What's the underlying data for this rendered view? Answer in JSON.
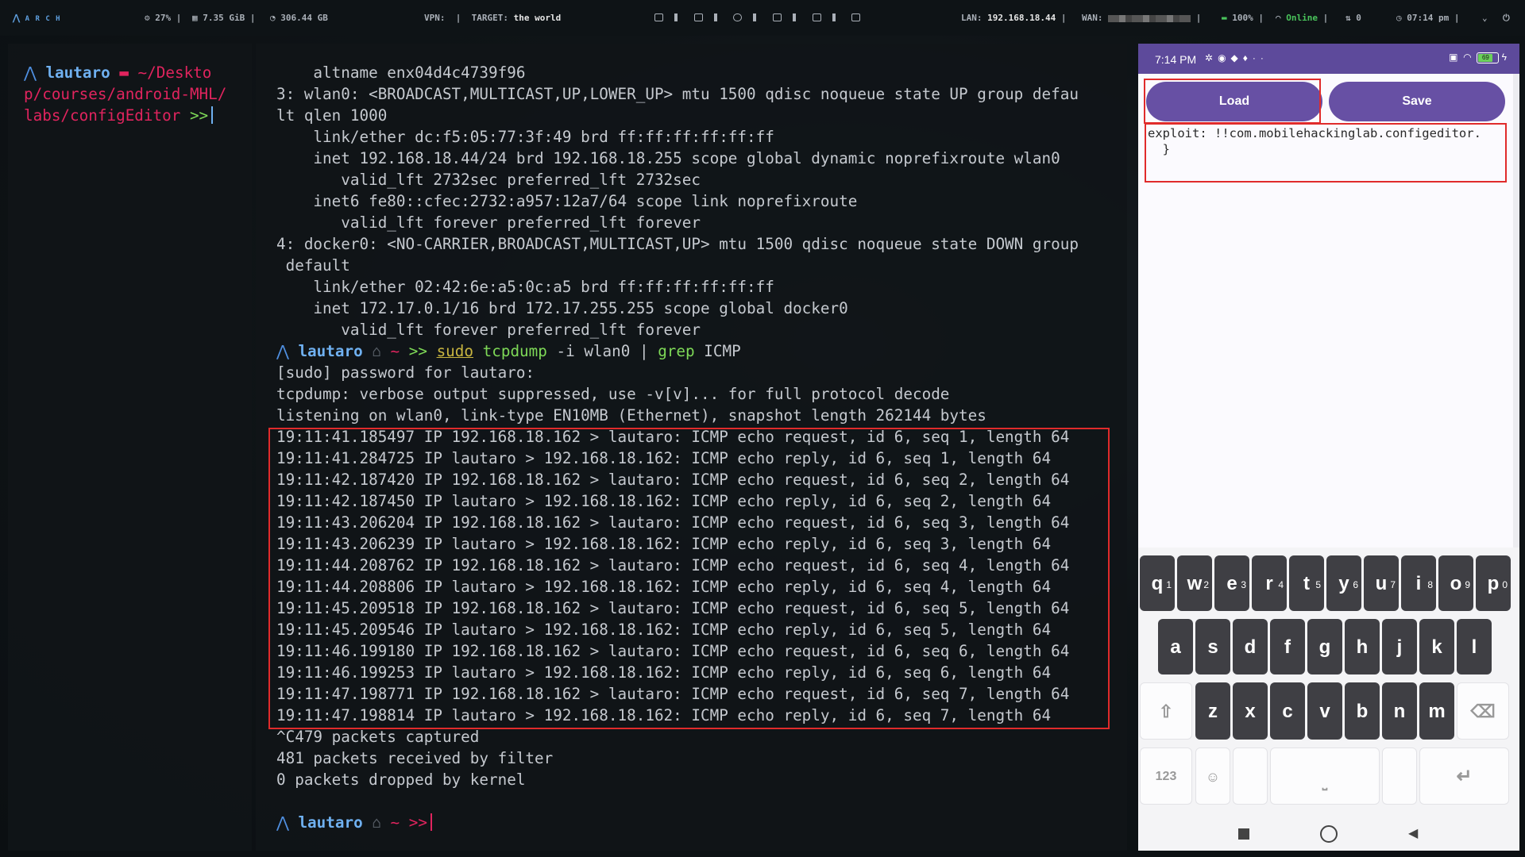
{
  "topbar": {
    "logo": "A R C H",
    "cpu": "27%",
    "ram": "7.35 GiB",
    "disk": "306.44 GB",
    "vpn_label": "VPN:",
    "target_label": "TARGET:",
    "target_value": "the world",
    "lan_label": "LAN:",
    "lan_value": "192.168.18.44",
    "wan_label": "WAN:",
    "battery": "100%",
    "network_status": "Online",
    "sync_count": "0",
    "clock": "07:14 pm"
  },
  "left_terminal": {
    "user": "lautaro",
    "path_line1": "~/Deskto",
    "path_line2": "p/courses/android-MHL/",
    "path_line3": "labs/configEditor",
    "prompt_symbol": ">>"
  },
  "main_terminal": {
    "lines": [
      "    altname enx04d4c4739f96",
      "3: wlan0: <BROADCAST,MULTICAST,UP,LOWER_UP> mtu 1500 qdisc noqueue state UP group defau",
      "lt qlen 1000",
      "    link/ether dc:f5:05:77:3f:49 brd ff:ff:ff:ff:ff:ff",
      "    inet 192.168.18.44/24 brd 192.168.18.255 scope global dynamic noprefixroute wlan0",
      "       valid_lft 2732sec preferred_lft 2732sec",
      "    inet6 fe80::cfec:2732:a957:12a7/64 scope link noprefixroute",
      "       valid_lft forever preferred_lft forever",
      "4: docker0: <NO-CARRIER,BROADCAST,MULTICAST,UP> mtu 1500 qdisc noqueue state DOWN group",
      " default",
      "    link/ether 02:42:6e:a5:0c:a5 brd ff:ff:ff:ff:ff:ff",
      "    inet 172.17.0.1/16 brd 172.17.255.255 scope global docker0",
      "       valid_lft forever preferred_lft forever"
    ],
    "prompt_user": "lautaro",
    "prompt_dir": "~",
    "prompt_symbol": ">>",
    "cmd_sudo": "sudo",
    "cmd_tcpdump": "tcpdump",
    "cmd_args1": " -i wlan0 | ",
    "cmd_grep": "grep",
    "cmd_args2": " ICMP",
    "sudo_line": "[sudo] password for lautaro:",
    "info_line1": "tcpdump: verbose output suppressed, use -v[v]... for full protocol decode",
    "info_line2": "listening on wlan0, link-type EN10MB (Ethernet), snapshot length 262144 bytes",
    "packets": [
      "19:11:41.185497 IP 192.168.18.162 > lautaro: ICMP echo request, id 6, seq 1, length 64",
      "19:11:41.284725 IP lautaro > 192.168.18.162: ICMP echo reply, id 6, seq 1, length 64",
      "19:11:42.187420 IP 192.168.18.162 > lautaro: ICMP echo request, id 6, seq 2, length 64",
      "19:11:42.187450 IP lautaro > 192.168.18.162: ICMP echo reply, id 6, seq 2, length 64",
      "19:11:43.206204 IP 192.168.18.162 > lautaro: ICMP echo request, id 6, seq 3, length 64",
      "19:11:43.206239 IP lautaro > 192.168.18.162: ICMP echo reply, id 6, seq 3, length 64",
      "19:11:44.208762 IP 192.168.18.162 > lautaro: ICMP echo request, id 6, seq 4, length 64",
      "19:11:44.208806 IP lautaro > 192.168.18.162: ICMP echo reply, id 6, seq 4, length 64",
      "19:11:45.209518 IP 192.168.18.162 > lautaro: ICMP echo request, id 6, seq 5, length 64",
      "19:11:45.209546 IP lautaro > 192.168.18.162: ICMP echo reply, id 6, seq 5, length 64",
      "19:11:46.199180 IP 192.168.18.162 > lautaro: ICMP echo request, id 6, seq 6, length 64",
      "19:11:46.199253 IP lautaro > 192.168.18.162: ICMP echo reply, id 6, seq 6, length 64",
      "19:11:47.198771 IP 192.168.18.162 > lautaro: ICMP echo request, id 6, seq 7, length 64",
      "19:11:47.198814 IP lautaro > 192.168.18.162: ICMP echo reply, id 6, seq 7, length 64"
    ],
    "summary": [
      "^C479 packets captured",
      "481 packets received by filter",
      "0 packets dropped by kernel"
    ]
  },
  "phone": {
    "status_time": "7:14 PM",
    "battery_level": "69",
    "load_button": "Load",
    "save_button": "Save",
    "editor_line1": "exploit: !!com.mobilehackinglab.configeditor.",
    "editor_line2": "  }",
    "keyboard_row1": [
      {
        "key": "q",
        "hint": "1"
      },
      {
        "key": "w",
        "hint": "2"
      },
      {
        "key": "e",
        "hint": "3"
      },
      {
        "key": "r",
        "hint": "4"
      },
      {
        "key": "t",
        "hint": "5"
      },
      {
        "key": "y",
        "hint": "6"
      },
      {
        "key": "u",
        "hint": "7"
      },
      {
        "key": "i",
        "hint": "8"
      },
      {
        "key": "o",
        "hint": "9"
      },
      {
        "key": "p",
        "hint": "0"
      }
    ],
    "keyboard_row2": [
      "a",
      "s",
      "d",
      "f",
      "g",
      "h",
      "j",
      "k",
      "l"
    ],
    "keyboard_row3": [
      "z",
      "x",
      "c",
      "v",
      "b",
      "n",
      "m"
    ],
    "numbers_key": "123"
  },
  "colors": {
    "accent_purple": "#6750a4",
    "highlight_red": "#e02b2b",
    "prompt_pink": "#e0245e",
    "prompt_green": "#7ed957"
  }
}
